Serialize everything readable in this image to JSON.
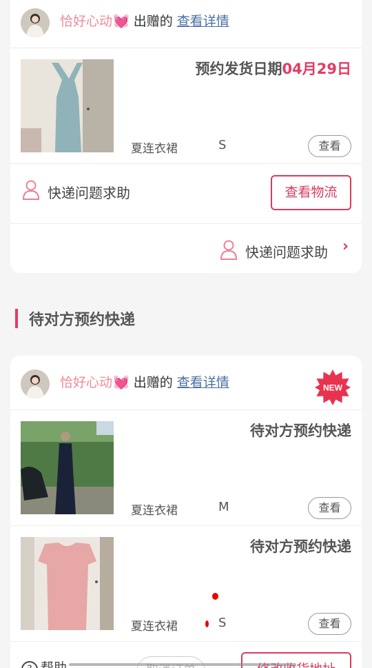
{
  "colors": {
    "accent": "#e63a62",
    "link": "#4a6fa5",
    "name_pink": "#f08a9a"
  },
  "order1": {
    "user_name": "恰好心动",
    "heart": "💓",
    "gift_label": "出赠的",
    "detail_link": "查看详情",
    "status_prefix": "预约发货日期",
    "status_date": "04月29日",
    "item_name": "夏连衣裙",
    "item_size": "S",
    "view_label": "查看",
    "help_label": "快递问题求助",
    "logistics_label": "查看物流",
    "footer_help_label": "快递问题求助",
    "chevron": "›"
  },
  "section": {
    "title": "待对方预约快递"
  },
  "order2": {
    "user_name": "恰好心动",
    "heart": "💓",
    "gift_label": "出赠的",
    "detail_link": "查看详情",
    "badge": "NEW",
    "items": [
      {
        "status": "待对方预约快递",
        "name": "夏连衣裙",
        "size": "M",
        "view_label": "查看"
      },
      {
        "status": "待对方预约快递",
        "name": "夏连衣裙",
        "size": "S",
        "view_label": "查看"
      }
    ],
    "help_label": "帮助",
    "ghost_label": "取消订单",
    "modify_label": "修改收货地址"
  }
}
